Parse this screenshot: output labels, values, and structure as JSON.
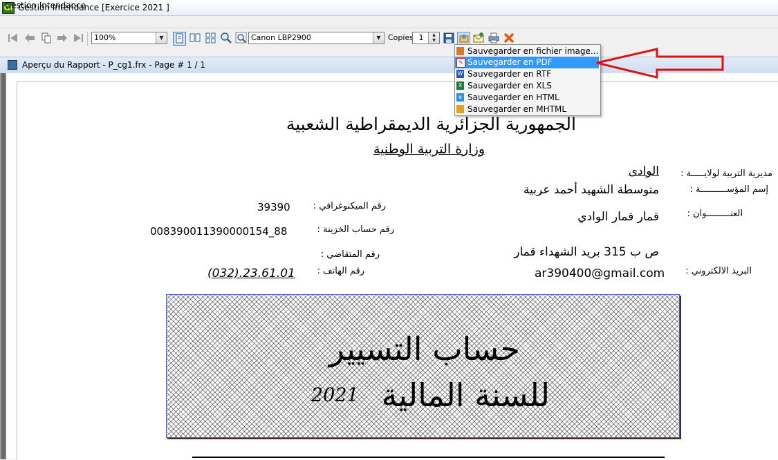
{
  "window": {
    "title": "Gestion Intendance [Exercice  2021 ]",
    "icon_text": "Gi"
  },
  "menubar": {
    "items": [
      "Gestion Intendance"
    ]
  },
  "toolbar": {
    "zoom": "100%",
    "printer": "Canon LBP2900",
    "copies_label": "Copies",
    "copies_value": "1"
  },
  "save_menu": {
    "items": [
      {
        "label": "Sauvegarder en fichier image...",
        "icon": "image-icon",
        "color": "#d9772b"
      },
      {
        "label": "Sauvegarder en PDF",
        "icon": "pdf-icon",
        "color": "#d02020",
        "selected": true
      },
      {
        "label": "Sauvegarder en RTF",
        "icon": "rtf-icon",
        "color": "#2a58b6"
      },
      {
        "label": "Sauvegarder en XLS",
        "icon": "xls-icon",
        "color": "#1d7a3a"
      },
      {
        "label": "Sauvegarder en HTML",
        "icon": "html-icon",
        "color": "#2f8fd8"
      },
      {
        "label": "Sauvegarder en MHTML",
        "icon": "mhtml-icon",
        "color": "#e0a020"
      }
    ]
  },
  "annotation": {
    "arrow_color": "#e01010"
  },
  "preview": {
    "title": "Aperçu du Rapport - P_cg1.frx - Page # 1 / 1"
  },
  "report": {
    "header_line1": "الجمهورية الجزائرية الديمقراطية الشعبية",
    "header_line2": "وزارة التربية الوطنية",
    "wilaya_label": "مديرية التربية لولايـــــة :",
    "wilaya_value": "الوادى",
    "institution_label": "إسم المؤســــــــــة :",
    "institution_value": "متوسطة الشهيد أحمد عربية",
    "address_label": "العنـــــــــوان :",
    "address_value": "قمار   قمار    الوادي",
    "address_line2": "ص ب 315 بريد الشهداء قمار",
    "email_label": "البريد  الالكتروني :",
    "email_value": "ar390400@gmail.com",
    "micro_label": "رقم الميكنوغرافي :",
    "micro_value": "39390",
    "treasury_label": "رقم حساب الخزينة :",
    "treasury_value": "008390011390000154_88",
    "litigant_label": "رقم  المتقاضي   :",
    "phone_label": "رقم  الهاتف   :",
    "phone_value": "(032).23.61.01",
    "box_title_line1": "حساب   التسيير",
    "box_title_line2": "للسنة المالية",
    "box_year": "2021"
  }
}
